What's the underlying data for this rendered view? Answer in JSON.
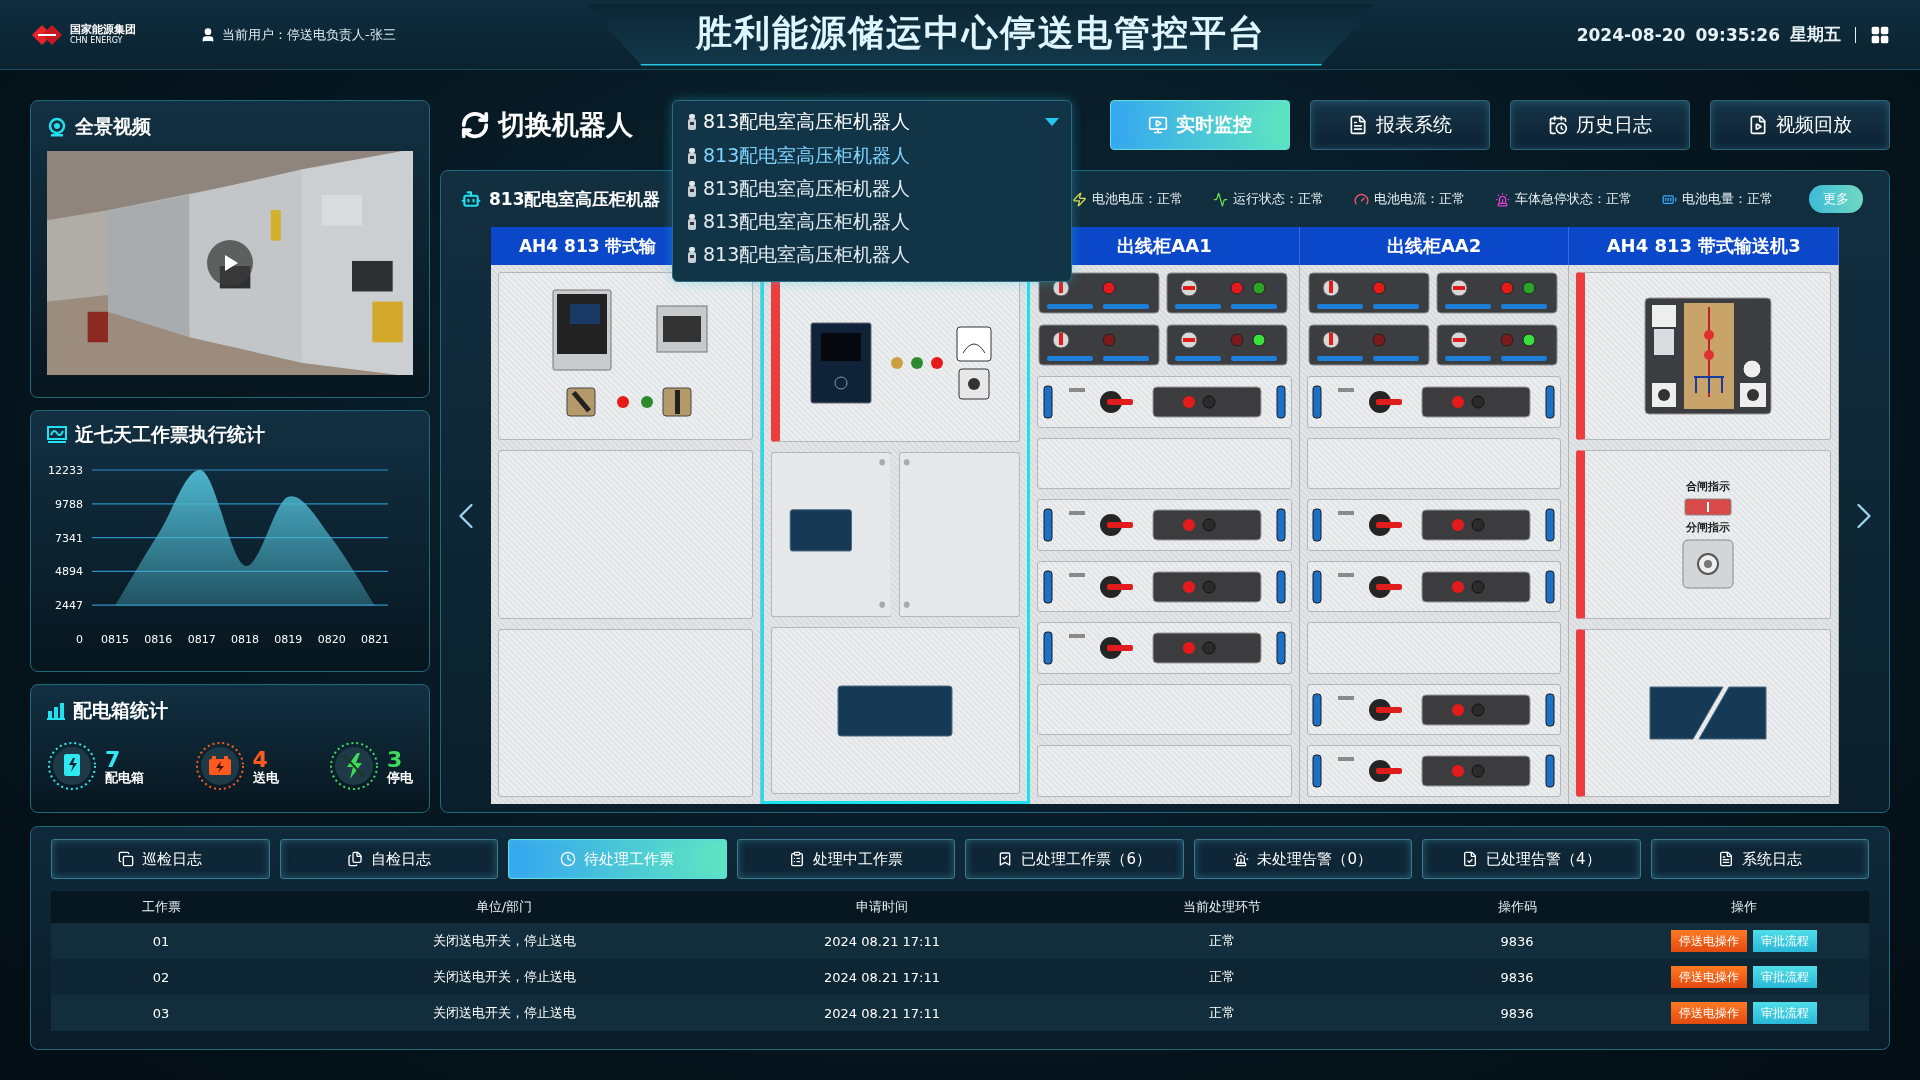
{
  "header": {
    "logo_cn": "国家能源集团",
    "logo_en": "CHN ENERGY",
    "user": "当前用户：停送电负责人-张三",
    "title": "胜利能源储运中心停送电管控平台",
    "date": "2024-08-20",
    "time": "09:35:26",
    "weekday": "星期五"
  },
  "video_panel": {
    "title": "全景视频"
  },
  "chart_panel": {
    "title": "近七天工作票执行统计",
    "chart_data": {
      "type": "area",
      "categories": [
        "0815",
        "0816",
        "0817",
        "0818",
        "0819",
        "0820",
        "0821"
      ],
      "series": [
        {
          "color": "#4cb4cc",
          "values": [
            2400,
            7600,
            12200,
            5300,
            10300,
            7300,
            2400
          ]
        }
      ],
      "ylim": [
        0,
        12233
      ],
      "grid": true,
      "yticks": [
        0,
        2447,
        4894,
        7341,
        9788,
        12233
      ]
    }
  },
  "box_panel": {
    "title": "配电箱统计",
    "stats": [
      {
        "kind": "box",
        "value": "7",
        "label": "配电箱",
        "color": "#2ee8f2"
      },
      {
        "kind": "power",
        "value": "4",
        "label": "送电",
        "color": "#ff5a1f"
      },
      {
        "kind": "off",
        "value": "3",
        "label": "停电",
        "color": "#3ddc5a"
      }
    ]
  },
  "robot_switch": {
    "label": "切换机器人",
    "dropdown": {
      "value": "813配电室高压柜机器人",
      "expanded": true,
      "options": [
        {
          "label": "813配电室高压柜机器人",
          "highlighted": true
        },
        {
          "label": "813配电室高压柜机器人",
          "highlighted": false
        },
        {
          "label": "813配电室高压柜机器人",
          "highlighted": false
        },
        {
          "label": "813配电室高压柜机器人",
          "highlighted": false
        }
      ]
    }
  },
  "nav_buttons": [
    {
      "label": "实时监控",
      "selected": true
    },
    {
      "label": "报表系统",
      "selected": false
    },
    {
      "label": "历史日志",
      "selected": false
    },
    {
      "label": "视频回放",
      "selected": false
    }
  ],
  "monitor": {
    "robot_name": "813配电室高压柜机器",
    "statuses": [
      {
        "kind": "voltage",
        "label": "电池电压：正常"
      },
      {
        "kind": "run",
        "label": "运行状态：正常"
      },
      {
        "kind": "current",
        "label": "电池电流：正常"
      },
      {
        "kind": "estop",
        "label": "车体急停状态：正常"
      },
      {
        "kind": "battery",
        "label": "电池电量：正常"
      }
    ],
    "more": "更多",
    "cabinets": [
      {
        "header": "AH4 813 带式输",
        "selected": false
      },
      {
        "selected": true
      },
      {
        "header": "出线柜AA1",
        "selected": false
      },
      {
        "header": "出线柜AA2",
        "selected": false
      },
      {
        "header": "AH4 813 带式输送机3",
        "selected": false,
        "indicators": [
          "合闸指示",
          "分闸指示"
        ]
      }
    ]
  },
  "tabs": [
    {
      "label": "巡检日志",
      "selected": false
    },
    {
      "label": "自检日志",
      "selected": false
    },
    {
      "label": "待处理工作票",
      "selected": true
    },
    {
      "label": "处理中工作票",
      "selected": false
    },
    {
      "label": "已处理工作票（6）",
      "selected": false
    },
    {
      "label": "未处理告警（0）",
      "selected": false
    },
    {
      "label": "已处理告警（4）",
      "selected": false
    },
    {
      "label": "系统日志",
      "selected": false
    }
  ],
  "table": {
    "columns": [
      "工作票",
      "单位/部门",
      "申请时间",
      "当前处理环节",
      "操作码",
      "操作"
    ],
    "rows": [
      {
        "cells": [
          "01",
          "关闭送电开关，停止送电",
          "2024 08.21 17:11",
          "正常",
          "9836"
        ],
        "actions": [
          "停送电操作",
          "审批流程"
        ]
      },
      {
        "cells": [
          "02",
          "关闭送电开关，停止送电",
          "2024 08.21 17:11",
          "正常",
          "9836"
        ],
        "actions": [
          "停送电操作",
          "审批流程"
        ]
      },
      {
        "cells": [
          "03",
          "关闭送电开关，停止送电",
          "2024 08.21 17:11",
          "正常",
          "9836"
        ],
        "actions": [
          "停送电操作",
          "审批流程"
        ]
      }
    ]
  }
}
